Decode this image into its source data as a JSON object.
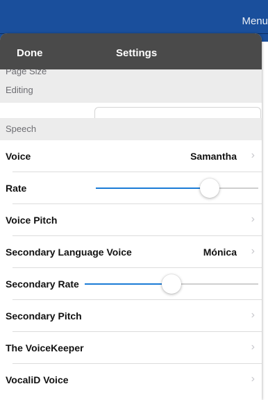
{
  "background": {
    "menu_label": "Menu"
  },
  "nav": {
    "done_label": "Done",
    "title": "Settings"
  },
  "sections": {
    "page_size": "Page Size",
    "editing": "Editing",
    "speech": "Speech"
  },
  "rows": [
    {
      "label": "Voice",
      "value": "Samantha",
      "chevron": "›"
    },
    {
      "label": "Rate",
      "slider_value": 0.7
    },
    {
      "label": "Voice Pitch",
      "chevron": "›"
    },
    {
      "label": "Secondary Language Voice",
      "value": "Mónica",
      "chevron": "›"
    },
    {
      "label": "Secondary Rate",
      "slider_value": 0.5
    },
    {
      "label": "Secondary Pitch",
      "chevron": "›"
    },
    {
      "label": "The VoiceKeeper",
      "chevron": "›"
    },
    {
      "label": "VocaliD Voice",
      "chevron": "›"
    }
  ],
  "colors": {
    "accent": "#1a7bd6",
    "nav_bar": "#4a4a4a",
    "app_bar": "#1a4f9c",
    "section_bg": "#ececec"
  }
}
